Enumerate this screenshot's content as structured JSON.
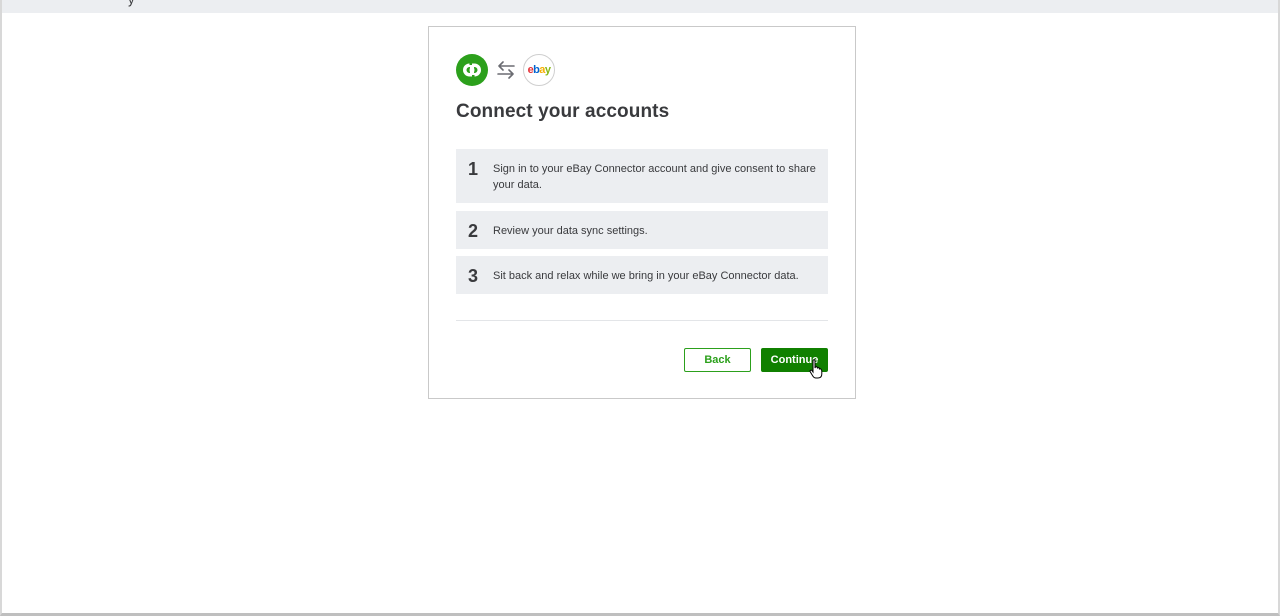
{
  "topbar": {
    "fragment": "y"
  },
  "dialog": {
    "logos": {
      "left_icon": "quickbooks-logo",
      "swap_icon": "swap-arrows-icon",
      "right_icon": "ebay-logo",
      "right_text": {
        "e": "e",
        "b": "b",
        "a": "a",
        "y": "y"
      }
    },
    "title": "Connect your accounts",
    "steps": [
      {
        "number": "1",
        "text": "Sign in to your eBay Connector account and give consent to share your data."
      },
      {
        "number": "2",
        "text": "Review your data sync settings."
      },
      {
        "number": "3",
        "text": "Sit back and relax while we bring in your eBay Connector data."
      }
    ],
    "buttons": {
      "back": "Back",
      "continue": "Continue"
    }
  },
  "colors": {
    "brand_green": "#2ca01c",
    "primary_button": "#108000",
    "step_background": "#eceef1",
    "text": "#393a3d"
  }
}
